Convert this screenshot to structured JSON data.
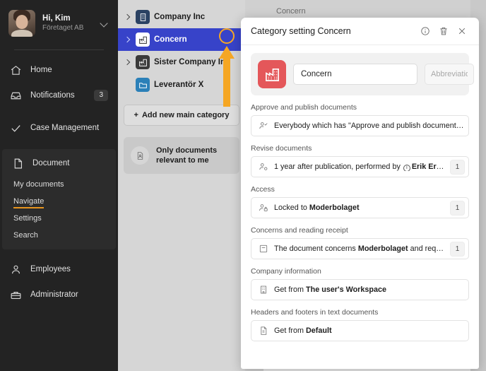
{
  "sidebar": {
    "user": {
      "greeting": "Hi, Kim",
      "org": "Företaget AB",
      "chevron_icon": "chevron-down-icon"
    },
    "items": [
      {
        "label": "Home",
        "icon": "home-icon"
      },
      {
        "label": "Notifications",
        "icon": "inbox-icon",
        "badge": "3"
      },
      {
        "label": "Case Management",
        "icon": "check-icon"
      }
    ],
    "document_group": {
      "label": "Document",
      "icon": "document-icon",
      "sub_items": [
        {
          "label": "My documents",
          "active": false
        },
        {
          "label": "Navigate",
          "active": true
        },
        {
          "label": "Settings",
          "active": false
        },
        {
          "label": "Search",
          "active": false
        }
      ]
    },
    "bottom_items": [
      {
        "label": "Employees",
        "icon": "person-icon"
      },
      {
        "label": "Administrator",
        "icon": "toolbox-icon"
      }
    ]
  },
  "tree": {
    "rows": [
      {
        "label": "Company Inc",
        "icon": "building-icon",
        "tile_color": "#2b4263",
        "icon_color": "#ffffff",
        "expandable": true,
        "selected": false
      },
      {
        "label": "Concern",
        "icon": "factory-icon",
        "tile_color": "#ffffff",
        "icon_color": "#2a2a2a",
        "expandable": true,
        "selected": true
      },
      {
        "label": "Sister Company Inc",
        "icon": "factory-icon",
        "tile_color": "#3a3a3a",
        "icon_color": "#ffffff",
        "expandable": true,
        "selected": false
      },
      {
        "label": "Leverantör X",
        "icon": "folder-icon",
        "tile_color": "#2b80b8",
        "icon_color": "#ffffff",
        "expandable": false,
        "selected": false
      }
    ],
    "add_button": {
      "label": "Add new main category",
      "plus": "+"
    },
    "relevant_card": {
      "label": "Only documents relevant to me",
      "icon": "document-person-icon"
    }
  },
  "main": {
    "title": "Concern"
  },
  "dialog": {
    "title": "Category setting Concern",
    "header_icons": [
      {
        "name": "info-icon"
      },
      {
        "name": "trash-icon"
      },
      {
        "name": "close-icon"
      }
    ],
    "name_card": {
      "icon": "factory-icon",
      "icon_color": "#e4575a",
      "name_value": "Concern",
      "abbreviation_placeholder": "Abbreviation",
      "abbreviation_value": ""
    },
    "fields": [
      {
        "label": "Approve and publish documents",
        "icon": "person-check-icon",
        "value": "Everybody which has \"Approve and publish documents\" enable…",
        "count": ""
      },
      {
        "label": "Revise documents",
        "icon": "person-gear-icon",
        "value_prefix": "1 year after publication, performed by ",
        "value_bold": "Erik Eriksson",
        "has_inline_info": true,
        "count": "1"
      },
      {
        "label": "Access",
        "icon": "person-lock-icon",
        "value_prefix": "Locked to ",
        "value_bold": "Moderbolaget",
        "count": "1"
      },
      {
        "label": "Concerns and reading receipt",
        "icon": "box-icon",
        "value_prefix": "The document concerns ",
        "value_bold": "Moderbolaget",
        "value_suffix": " and require readin…",
        "count": "1"
      },
      {
        "label": "Company information",
        "icon": "building-small-icon",
        "value_prefix": "Get from ",
        "value_bold": "The user's Workspace",
        "count": ""
      },
      {
        "label": "Headers and footers in text documents",
        "icon": "file-icon",
        "value_prefix": "Get from ",
        "value_bold": "Default",
        "count": ""
      }
    ]
  },
  "annotation": {
    "circle": {
      "name": "highlight-circle",
      "color": "#f5a623"
    },
    "arrow": {
      "name": "pointer-arrow",
      "color": "#f5a623"
    }
  },
  "colors": {
    "accent_blue": "#3743c9",
    "accent_orange": "#e8951f",
    "sidebar_bg": "#232323",
    "red_tile": "#e4575a"
  }
}
